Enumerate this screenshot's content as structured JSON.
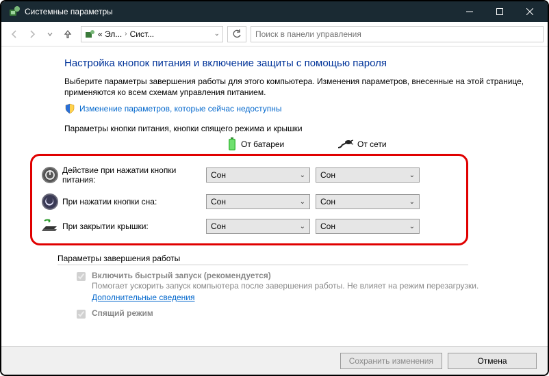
{
  "window": {
    "title": "Системные параметры"
  },
  "breadcrumb": {
    "level1": "« Эл...",
    "level2": "Сист..."
  },
  "search": {
    "placeholder": "Поиск в панели управления"
  },
  "page": {
    "title": "Настройка кнопок питания и включение защиты с помощью пароля",
    "description": "Выберите параметры завершения работы для этого компьютера. Изменения параметров, внесенные на этой странице, применяются ко всем схемам управления питанием.",
    "unlock_link": "Изменение параметров, которые сейчас недоступны",
    "section_label": "Параметры кнопки питания, кнопки спящего режима и крышки"
  },
  "headers": {
    "battery": "От батареи",
    "plugged": "От сети"
  },
  "rows": {
    "power": {
      "label": "Действие при нажатии кнопки питания:",
      "battery": "Сон",
      "plugged": "Сон"
    },
    "sleep": {
      "label": "При нажатии кнопки сна:",
      "battery": "Сон",
      "plugged": "Сон"
    },
    "lid": {
      "label": "При закрытии крышки:",
      "battery": "Сон",
      "plugged": "Сон"
    }
  },
  "shutdown": {
    "label": "Параметры завершения работы",
    "fast_start_title": "Включить быстрый запуск (рекомендуется)",
    "fast_start_desc": "Помогает ускорить запуск компьютера после завершения работы. Не влияет на режим перезагрузки. ",
    "fast_start_link": "Дополнительные сведения",
    "sleep_title": "Спящий режим"
  },
  "footer": {
    "save": "Сохранить изменения",
    "cancel": "Отмена"
  }
}
